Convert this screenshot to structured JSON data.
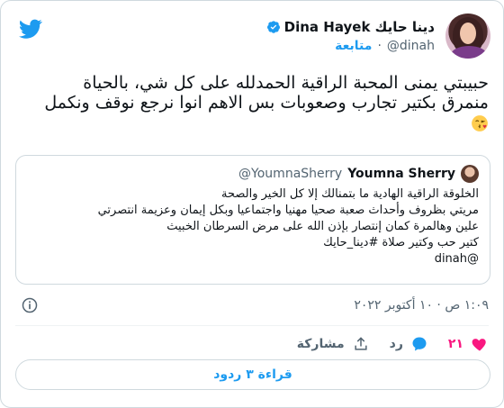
{
  "author": {
    "name": "Dina Hayek دينا حايك",
    "handle": "@dinah",
    "follow_label": "متابعة",
    "verified_icon": "verified-badge-icon",
    "verified_color": "#1d9bf0"
  },
  "tweet": {
    "text_line1": "حبيبتي يمنى المحبة الراقية الحمدلله على كل شي، بالحياة",
    "text_line2": "منمرق بكتير تجارب وصعوبات بس الاهم انوا نرجع نوقف ونكمل",
    "emoji": "face-blowing-kiss-icon"
  },
  "quoted": {
    "name": "Youmna Sherry",
    "handle": "@YoumnaSherry",
    "lines": [
      "الخلوقة الراقية الهادية ما بتمنالك إلا كل الخير والصحة",
      "مريتي بظروف وأحداث صعبة صحيا مهنيا واجتماعيا وبكل إيمان وعزيمة انتصرتي",
      "علين وهالمرة كمان إنتصار بإذن الله على مرض السرطان الخبيث",
      "كتير حب وكتير صلاة  #دينا_حايك",
      "@dinah"
    ]
  },
  "meta": {
    "timestamp": "١:٠٩ ص · ١٠ أكتوبر ٢٠٢٢",
    "info_icon": "info-icon"
  },
  "actions": {
    "likes_count": "٢١",
    "reply_label": "رد",
    "share_label": "مشاركة",
    "colors": {
      "like": "#f91880",
      "reply": "#1d9bf0",
      "muted": "#536471"
    }
  },
  "replies_button": {
    "label": "قراءة ٣ ردود"
  },
  "brand": {
    "logo": "twitter-bird-icon",
    "color": "#1d9bf0"
  }
}
